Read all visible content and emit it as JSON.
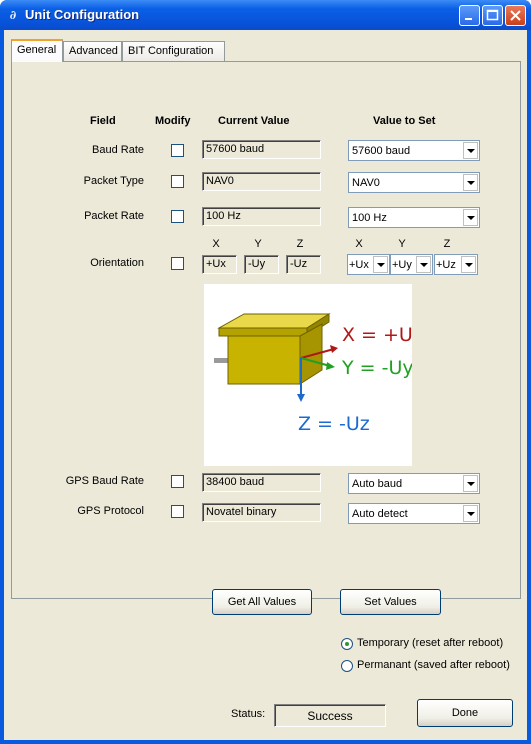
{
  "window": {
    "title": "Unit Configuration",
    "icon": "app-icon"
  },
  "tabs": [
    "General",
    "Advanced",
    "BIT Configuration"
  ],
  "active_tab": 0,
  "headers": {
    "field": "Field",
    "modify": "Modify",
    "current": "Current Value",
    "set": "Value to Set"
  },
  "rows": {
    "baud_rate": {
      "label": "Baud Rate",
      "current": "57600 baud",
      "set": "57600 baud"
    },
    "packet_type": {
      "label": "Packet Type",
      "current": "NAV0",
      "set": "NAV0"
    },
    "packet_rate": {
      "label": "Packet Rate",
      "current": "100 Hz",
      "set": "100 Hz"
    },
    "orientation": {
      "label": "Orientation",
      "axes": [
        "X",
        "Y",
        "Z"
      ],
      "current": [
        "+Ux",
        "-Uy",
        "-Uz"
      ],
      "set": [
        "+Ux",
        "+Uy",
        "+Uz"
      ]
    },
    "gps_baud_rate": {
      "label": "GPS Baud Rate",
      "current": "38400 baud",
      "set": "Auto baud"
    },
    "gps_protocol": {
      "label": "GPS Protocol",
      "current": "Novatel binary",
      "set": "Auto detect"
    }
  },
  "diagram": {
    "x_label": "X = +Ux",
    "y_label": "Y = -Uy",
    "z_label": "Z = -Uz",
    "colors": {
      "x": "#b01818",
      "y": "#22a022",
      "z": "#1a6ad0",
      "box": "#c8b400"
    }
  },
  "buttons": {
    "get_all": "Get All Values",
    "set_values": "Set Values",
    "done": "Done"
  },
  "options": {
    "temporary": "Temporary (reset after reboot)",
    "permanent": "Permanant (saved after reboot)",
    "selected": "temporary"
  },
  "status": {
    "label": "Status:",
    "value": "Success"
  }
}
